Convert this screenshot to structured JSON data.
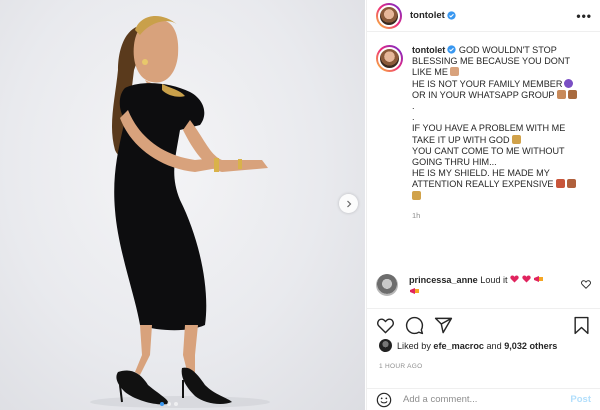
{
  "post": {
    "username": "tontolet",
    "more_label": "•••",
    "caption": {
      "username": "tontolet",
      "lines": [
        "GOD WOULDN'T STOP",
        "BLESSING ME BECAUSE YOU DONT",
        "LIKE ME",
        "HE IS NOT YOUR FAMILY MEMBER",
        "OR IN YOUR WHATSAPP GROUP",
        ".",
        ".",
        "IF YOU HAVE A PROBLEM WITH ME",
        "TAKE IT UP WITH GOD",
        "YOU CANT COME TO ME WITHOUT",
        "GOING THRU HIM...",
        "HE IS MY SHIELD. HE MADE MY",
        "ATTENTION REALLY EXPENSIVE"
      ],
      "time_ago": "1h"
    },
    "comment": {
      "username": "princessa_anne",
      "text": "Loud it"
    },
    "likes": {
      "prefix": "Liked by",
      "liker": "efe_macroc",
      "joiner": "and",
      "others": "9,032 others"
    },
    "posted_ago": "1 HOUR AGO",
    "add_comment_placeholder": "Add a comment...",
    "post_button_label": "Post"
  },
  "colors": {
    "accent": "#3897f0",
    "post_button": "#b2dffc",
    "heart_emoji": "#e0245e",
    "dress": "#0d0d0f"
  },
  "icons": [
    "verified-badge-icon",
    "more-options-icon",
    "next-arrow-icon",
    "heart-icon",
    "comment-icon",
    "share-icon",
    "bookmark-icon",
    "emoji-icon"
  ]
}
